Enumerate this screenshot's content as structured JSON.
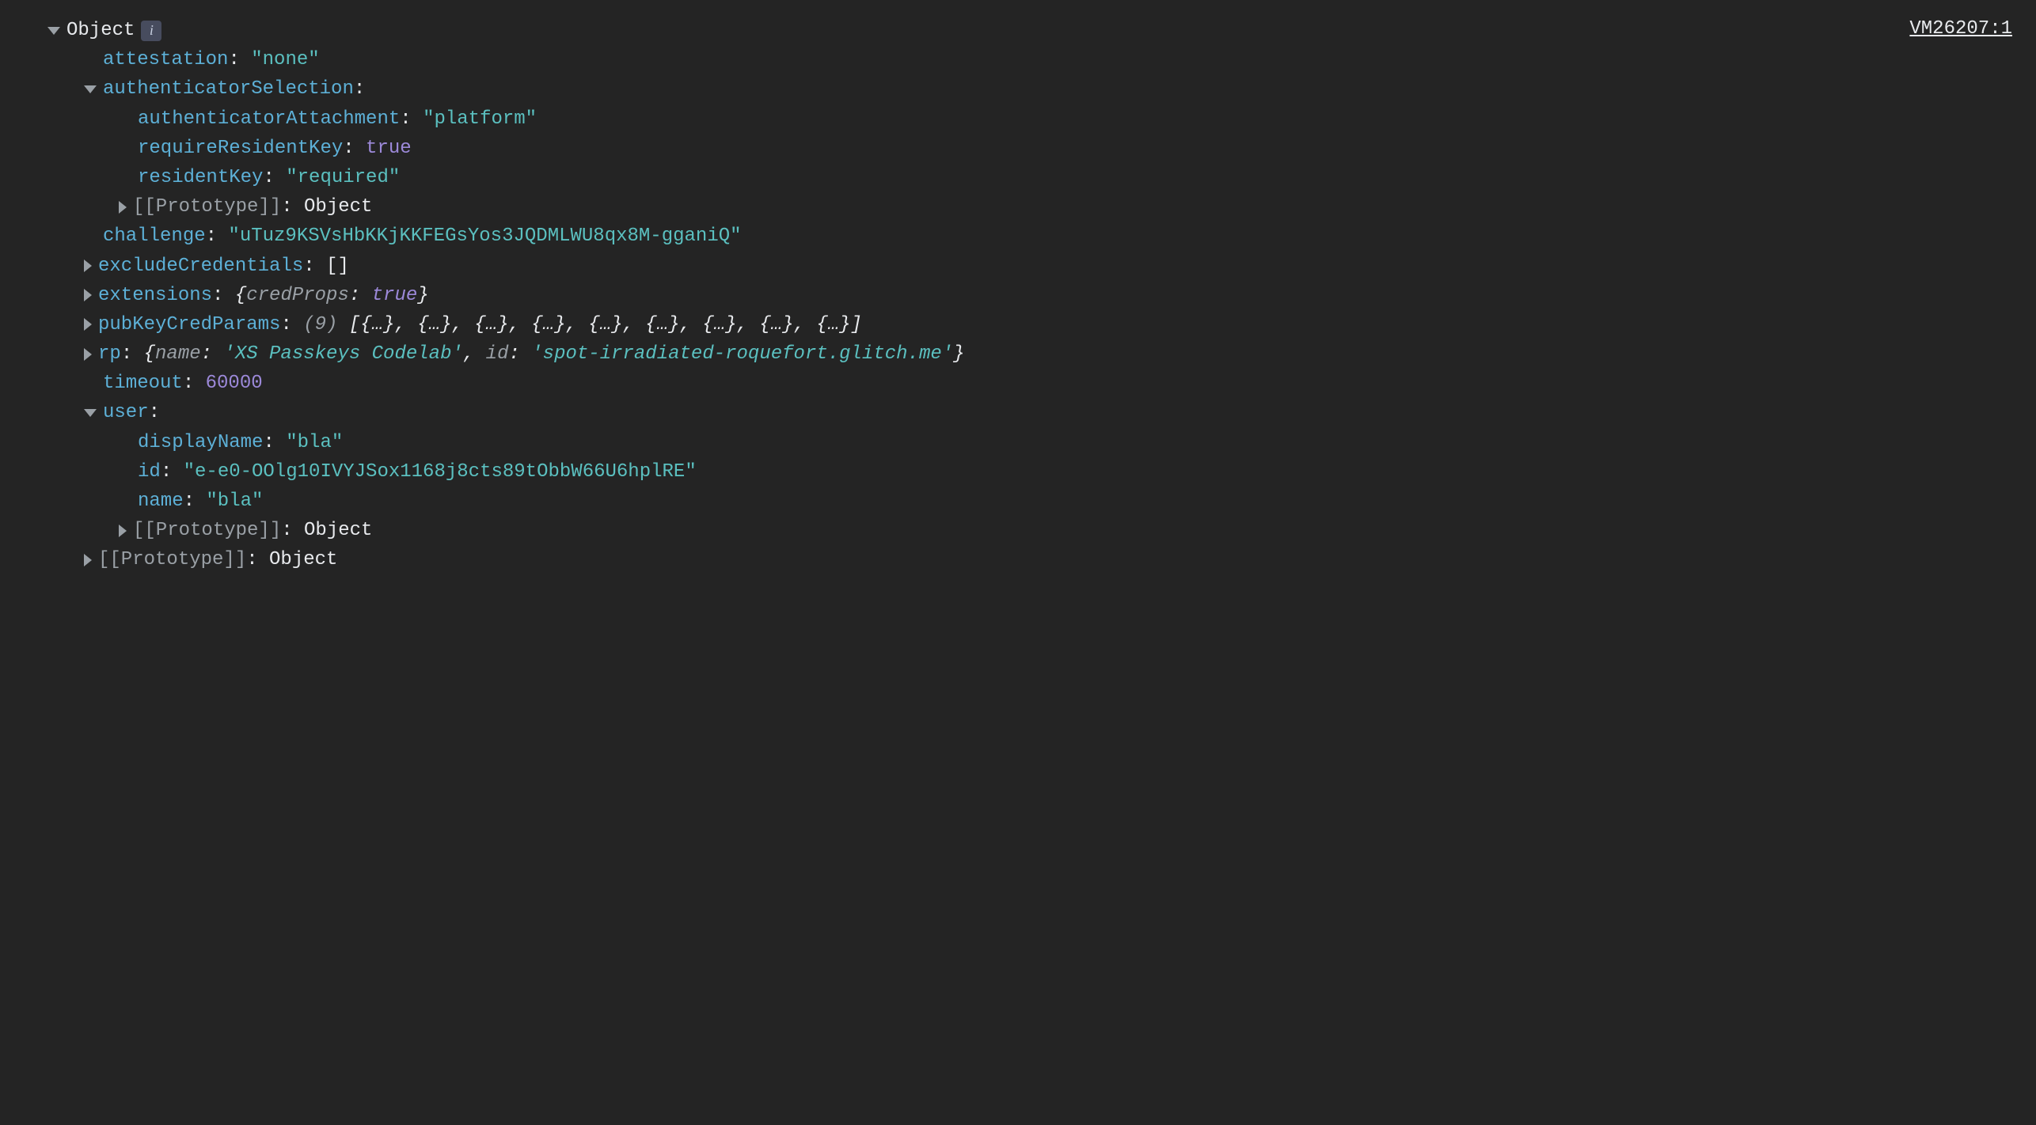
{
  "source": {
    "text": "VM26207:1"
  },
  "root": {
    "label": "Object",
    "info": "i"
  },
  "props": {
    "attestation": {
      "key": "attestation",
      "value": "\"none\""
    },
    "authenticatorSelection": {
      "key": "authenticatorSelection",
      "authenticatorAttachment": {
        "key": "authenticatorAttachment",
        "value": "\"platform\""
      },
      "requireResidentKey": {
        "key": "requireResidentKey",
        "value": "true"
      },
      "residentKey": {
        "key": "residentKey",
        "value": "\"required\""
      },
      "prototype": {
        "key": "[[Prototype]]",
        "value": "Object"
      }
    },
    "challenge": {
      "key": "challenge",
      "value": "\"uTuz9KSVsHbKKjKKFEGsYos3JQDMLWU8qx8M-gganiQ\""
    },
    "excludeCredentials": {
      "key": "excludeCredentials",
      "value": "[]"
    },
    "extensions": {
      "key": "extensions",
      "open": "{",
      "inner_key": "credProps",
      "inner_val": "true",
      "close": "}"
    },
    "pubKeyCredParams": {
      "key": "pubKeyCredParams",
      "count": "(9)",
      "preview": "[{…}, {…}, {…}, {…}, {…}, {…}, {…}, {…}, {…}]"
    },
    "rp": {
      "key": "rp",
      "open": "{",
      "name_key": "name",
      "name_val": "'XS Passkeys Codelab'",
      "id_key": "id",
      "id_val": "'spot-irradiated-roquefort.glitch.me'",
      "close": "}"
    },
    "timeout": {
      "key": "timeout",
      "value": "60000"
    },
    "user": {
      "key": "user",
      "displayName": {
        "key": "displayName",
        "value": "\"bla\""
      },
      "id": {
        "key": "id",
        "value": "\"e-e0-OOlg10IVYJSox1168j8cts89tObbW66U6hplRE\""
      },
      "name": {
        "key": "name",
        "value": "\"bla\""
      },
      "prototype": {
        "key": "[[Prototype]]",
        "value": "Object"
      }
    },
    "prototype": {
      "key": "[[Prototype]]",
      "value": "Object"
    }
  }
}
